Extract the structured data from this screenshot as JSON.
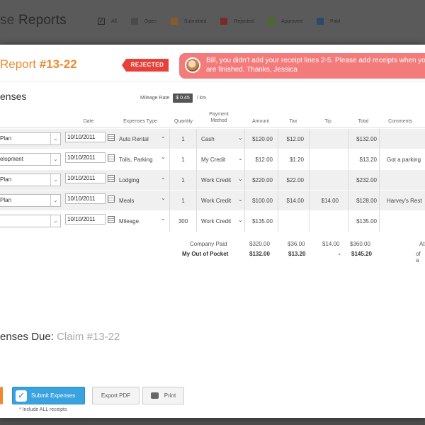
{
  "background": {
    "title_part1": "se",
    "title_part2": "Reports",
    "filters": [
      {
        "label": "All",
        "color": "#555555",
        "checked": true
      },
      {
        "label": "Open",
        "color": "#4a4a4a"
      },
      {
        "label": "Submitted",
        "color": "#8a5a2a"
      },
      {
        "label": "Rejected",
        "color": "#7a2a2a"
      },
      {
        "label": "Approved",
        "color": "#4a6a2a"
      },
      {
        "label": "Paid",
        "color": "#2a4a6a"
      }
    ]
  },
  "modal": {
    "title_prefix": "Report",
    "title_number": "#13-22",
    "status_badge": "REJECTED",
    "message": "Bill, you didn't add your receipt lines 2-5. Please add receipts when you are finished. Thanks, Jessica",
    "section_title": "enses",
    "mileage_label": "Mileage Rate",
    "mileage_value": "$ 0.45",
    "mileage_unit": "/ km",
    "columns": {
      "date": "Date",
      "type": "Expenses Type",
      "quantity": "Quantity",
      "payment": "Payment Method",
      "amount": "Amount",
      "tax": "Tax",
      "tip": "Tip",
      "total": "Total",
      "comments": "Comments"
    },
    "rows": [
      {
        "project": "Plan",
        "date": "10/10/2011",
        "type": "Auto Rental",
        "quantity": "1",
        "payment": "Cash",
        "amount": "$120.00",
        "tax": "$12.00",
        "tip": "",
        "total": "$132.00",
        "comment": ""
      },
      {
        "project": "elopment",
        "date": "10/10/2011",
        "type": "Tolls, Parking",
        "quantity": "1",
        "payment": "My Credit",
        "amount": "$12.00",
        "tax": "$1.20",
        "tip": "",
        "total": "$13.20",
        "comment": "Got a parking"
      },
      {
        "project": "Plan",
        "date": "10/10/2011",
        "type": "Lodging",
        "quantity": "1",
        "payment": "Work Credit",
        "amount": "$220.00",
        "tax": "$22.00",
        "tip": "",
        "total": "$232.00",
        "comment": ""
      },
      {
        "project": "Plan",
        "date": "10/10/2011",
        "type": "Meals",
        "quantity": "1",
        "payment": "Work Credit",
        "amount": "$100.00",
        "tax": "$14.00",
        "tip": "$14.00",
        "total": "$128.00",
        "comment": "Harvey's Rest"
      },
      {
        "project": "",
        "date": "10/10/2011",
        "type": "Mileage",
        "quantity": "300",
        "payment": "Work Credit",
        "amount": "$135.00",
        "tax": "",
        "tip": "",
        "total": "$135.00",
        "comment": ""
      }
    ],
    "totals": {
      "company_label": "Company Paid",
      "company_amount": "$320.00",
      "company_tax": "$36.00",
      "company_tip": "$14.00",
      "company_total": "$360.00",
      "company_note": "At",
      "pocket_label": "My Out of Pocket",
      "pocket_amount": "$132.00",
      "pocket_tax": "$13.20",
      "pocket_tip": "-",
      "pocket_total": "$145.20",
      "pocket_note": "of a"
    },
    "due_label": "enses Due:",
    "due_claim": "Claim #13-22",
    "buttons": {
      "submit": "Submit Expenses",
      "export": "Export PDF",
      "print": "Print"
    },
    "note": "* Include ALL receipts"
  }
}
